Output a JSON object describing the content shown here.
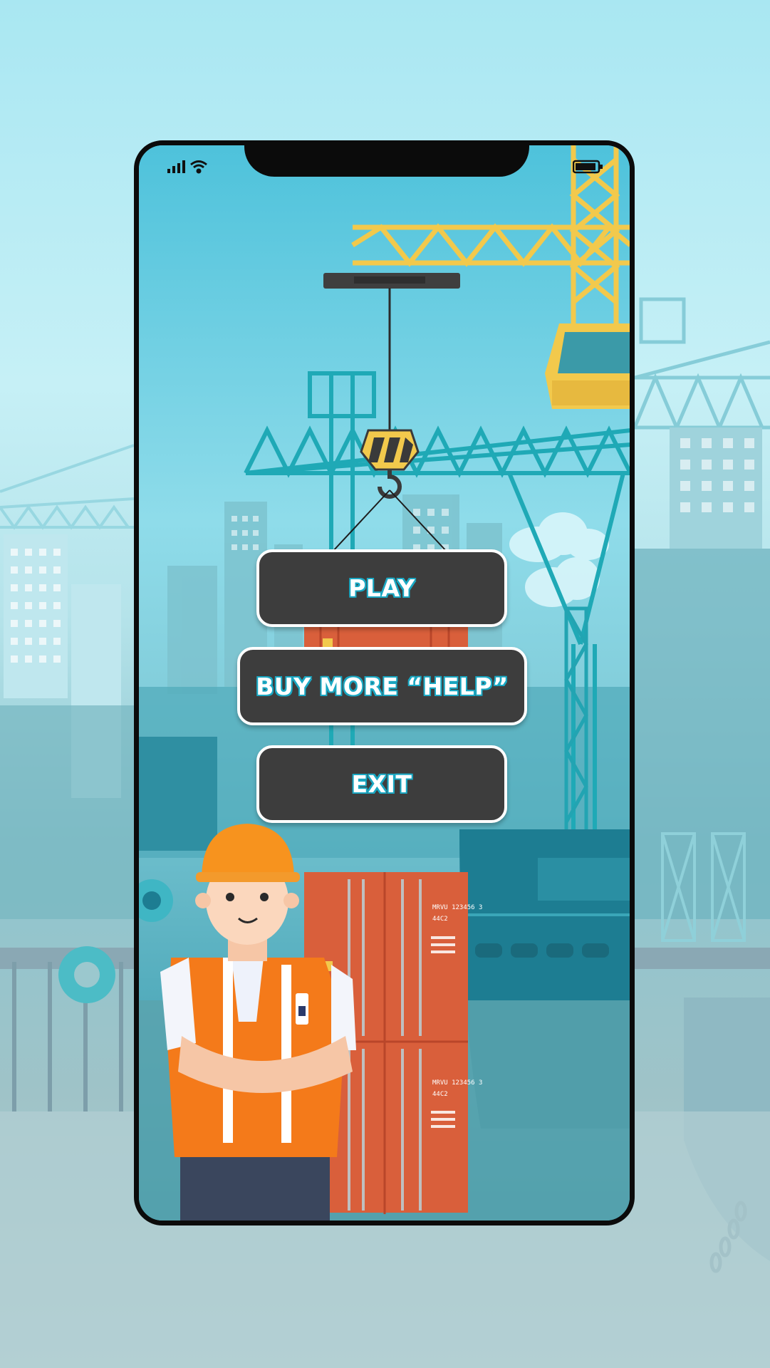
{
  "menu": {
    "play_label": "PLAY",
    "buy_help_label": "BUY MORE “HELP”",
    "exit_label": "EXIT"
  },
  "status_bar": {
    "signal_icon": "cellular-signal-icon",
    "wifi_icon": "wifi-icon",
    "battery_icon": "battery-icon",
    "battery_level": 0.85
  },
  "container": {
    "code_primary": "MRVU 123456 3",
    "code_secondary": "44C2"
  },
  "colors": {
    "button_fill": "#3d3d3d",
    "button_border": "#ffffff",
    "label_outline": "#1aa8c3",
    "crane_yellow": "#f2c94c",
    "crane_teal": "#1fa9b6",
    "container_orange": "#d95f3b",
    "vest_orange": "#f47a1a"
  }
}
